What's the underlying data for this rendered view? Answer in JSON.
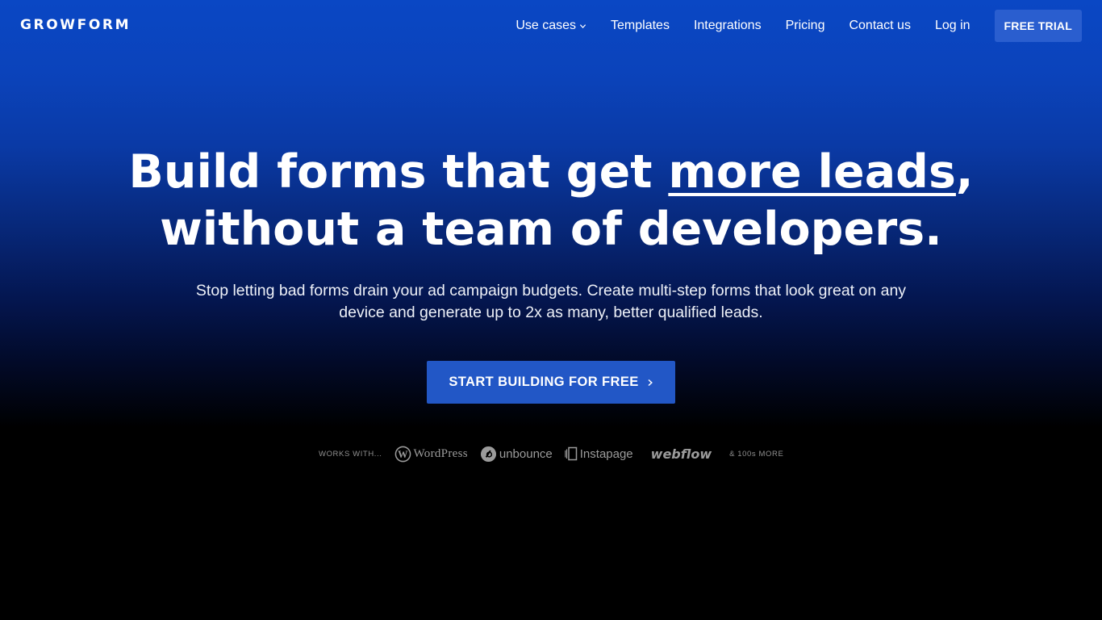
{
  "header": {
    "logo": "GROWFORM",
    "nav": [
      {
        "label": "Use cases",
        "icon": "chevron-down-icon"
      },
      {
        "label": "Templates"
      },
      {
        "label": "Integrations"
      },
      {
        "label": "Pricing"
      },
      {
        "label": "Contact us"
      },
      {
        "label": "Log in"
      }
    ],
    "cta_label": "FREE TRIAL"
  },
  "hero": {
    "title_part1": "Build forms that get ",
    "title_highlight": "more leads",
    "title_part2": ",",
    "title_line2": "without a team of developers.",
    "subtitle": "Stop letting bad forms drain your ad campaign budgets. Create multi-step forms that look great on any device and generate up to 2x as many, better qualified leads.",
    "cta_label": "START BUILDING FOR FREE",
    "cta_icon": "chevron-right-icon"
  },
  "integrations": {
    "label": "WORKS WITH...",
    "brands": [
      {
        "name": "WordPress",
        "icon": "wordpress-logo-icon"
      },
      {
        "name": "unbounce",
        "icon": "unbounce-logo-icon"
      },
      {
        "name": "Instapage",
        "icon": "instapage-logo-icon"
      },
      {
        "name": "webflow",
        "icon": "webflow-logo-icon"
      }
    ],
    "more_label": "& 100s MORE"
  },
  "colors": {
    "accent": "#2257c6",
    "nav_button": "#2a5ecf",
    "gradient_top": "#0a47c4",
    "gradient_bottom": "#000000",
    "muted_logo": "#9b9b9b"
  }
}
